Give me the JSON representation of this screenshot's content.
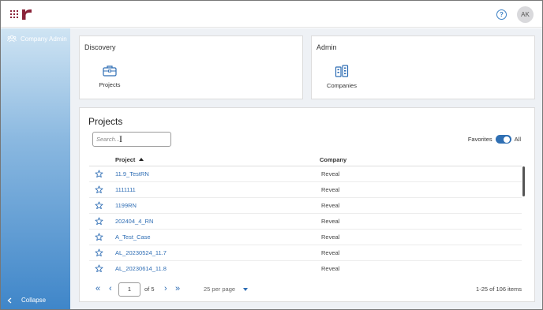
{
  "header": {
    "avatar_initials": "AK",
    "help_label": "?"
  },
  "sidebar": {
    "item_label": "Company Admin",
    "collapse_label": "Collapse"
  },
  "discovery": {
    "title": "Discovery",
    "tile_label": "Projects"
  },
  "admin": {
    "title": "Admin",
    "tile_label": "Companies"
  },
  "projects": {
    "title": "Projects",
    "search_placeholder": "Search...",
    "favorites_label": "Favorites",
    "all_label": "All",
    "columns": {
      "project": "Project",
      "company": "Company"
    },
    "rows": [
      {
        "project": "11.9_TestRN",
        "company": "Reveal"
      },
      {
        "project": "1111111",
        "company": "Reveal"
      },
      {
        "project": "1199RN",
        "company": "Reveal"
      },
      {
        "project": "202404_4_RN",
        "company": "Reveal"
      },
      {
        "project": "A_Test_Case",
        "company": "Reveal"
      },
      {
        "project": "AL_20230524_11.7",
        "company": "Reveal"
      },
      {
        "project": "AL_20230614_11.8",
        "company": "Reveal"
      }
    ]
  },
  "pager": {
    "current_page": "1",
    "of_text": "of 5",
    "per_page": "25 per page",
    "items_text": "1-25 of 106 items"
  },
  "colors": {
    "brand": "#8a2339",
    "accent": "#2e6db4",
    "toggle": "#2f6fb3"
  }
}
